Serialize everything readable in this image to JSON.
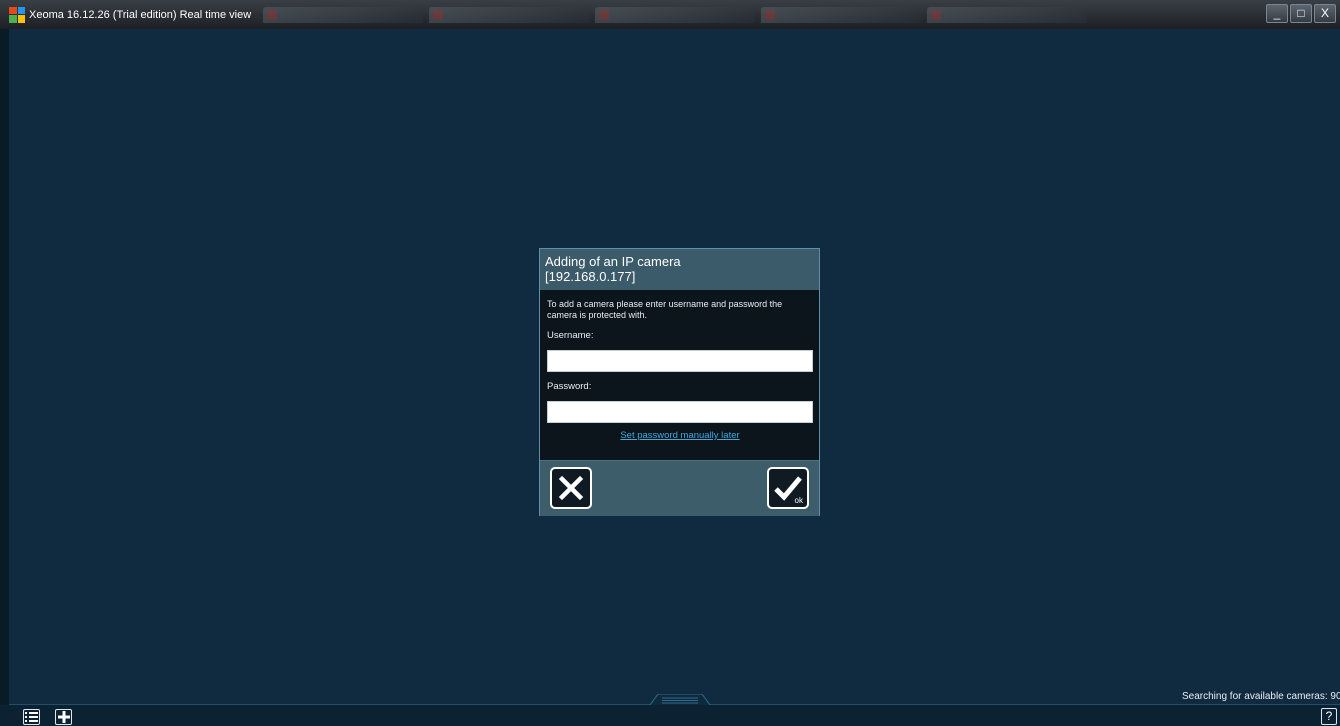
{
  "window": {
    "title": "Xeoma 16.12.26 (Trial edition) Real time view",
    "controls": {
      "minimize": "_",
      "maximize": "□",
      "close": "X"
    }
  },
  "dialog": {
    "title": "Adding of an IP camera",
    "subtitle": "[192.168.0.177]",
    "description": "To add a camera please enter username and password the camera is protected with.",
    "username_label": "Username:",
    "username_value": "",
    "password_label": "Password:",
    "password_value": "",
    "set_password_link": "Set password manually later",
    "ok_caption": "ok"
  },
  "statusbar": {
    "status_text": "Searching for available cameras: 90",
    "help_label": "?"
  },
  "colors": {
    "background": "#0f2a3e",
    "dialog_header": "#3b5a6a",
    "link": "#3fa9e0"
  }
}
